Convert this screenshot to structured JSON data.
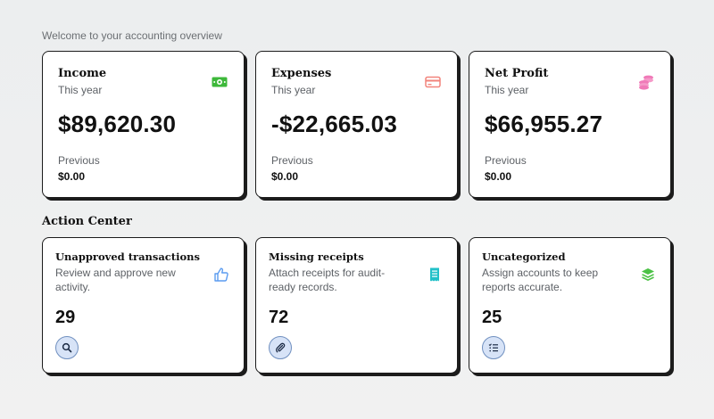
{
  "header": {
    "welcome": "Welcome to your accounting overview"
  },
  "stats": [
    {
      "title": "Income",
      "subtitle": "This year",
      "amount": "$89,620.30",
      "previous_label": "Previous",
      "previous_value": "$0.00",
      "icon": "money-icon",
      "icon_color": "#3db83a"
    },
    {
      "title": "Expenses",
      "subtitle": "This year",
      "amount": "-$22,665.03",
      "previous_label": "Previous",
      "previous_value": "$0.00",
      "icon": "credit-card-icon",
      "icon_color": "#f2837b"
    },
    {
      "title": "Net Profit",
      "subtitle": "This year",
      "amount": "$66,955.27",
      "previous_label": "Previous",
      "previous_value": "$0.00",
      "icon": "coins-icon",
      "icon_color": "#f07ab8"
    }
  ],
  "action_center": {
    "title": "Action Center",
    "cards": [
      {
        "title": "Unapproved transactions",
        "description": "Review and approve new activity.",
        "count": "29",
        "icon": "thumbs-up-icon",
        "icon_color": "#5b9cf0",
        "button_icon": "search-icon"
      },
      {
        "title": "Missing receipts",
        "description": "Attach receipts for audit-ready records.",
        "count": "72",
        "icon": "receipt-icon",
        "icon_color": "#22c0c8",
        "button_icon": "paperclip-icon"
      },
      {
        "title": "Uncategorized",
        "description": "Assign accounts to keep reports accurate.",
        "count": "25",
        "icon": "layers-icon",
        "icon_color": "#4cc246",
        "button_icon": "list-check-icon"
      }
    ]
  },
  "colors": {
    "card_border": "#1c1c1c",
    "button_bg": "#d7e3f7",
    "button_border": "#6f8fbf"
  }
}
